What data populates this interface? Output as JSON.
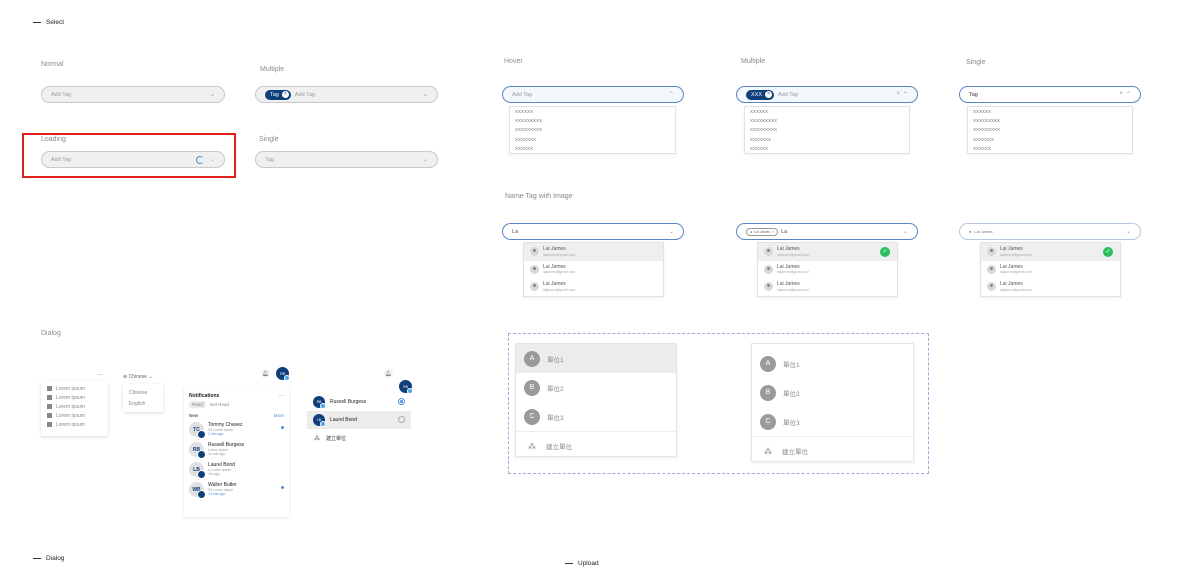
{
  "sections": {
    "select": "Select",
    "dialog": "Dialog",
    "upload": "Upload"
  },
  "labels": {
    "normal": "Normal",
    "multiple_left": "Multiple",
    "loading": "Loading",
    "single_left": "Single",
    "hover": "Hover",
    "multiple_right": "Multiple",
    "single_right": "Single",
    "name_tag_with_image": "Name Tag with Image",
    "dialog": "Dialog"
  },
  "selects": {
    "normal_placeholder": "Add Tag",
    "multiple_tag": "Tag",
    "multiple_placeholder": "Add Tag",
    "loading_placeholder": "Add Tag",
    "single_placeholder": "Tag",
    "hover_placeholder": "Add Tag",
    "multi_open_tag": "XXX",
    "multi_open_placeholder": "Add Tag",
    "single_open_value": "Tag"
  },
  "dropdown_options": [
    "XXXXXX",
    "XXXXXXXXX",
    "XXXXXXXXX",
    "XXXXXXX",
    "XXXXXX"
  ],
  "name_tag": {
    "input_value": "La",
    "chip_label": "Lai James",
    "chip_value_2": "La",
    "single_chip": "Lai James",
    "people": [
      {
        "name": "Lai James",
        "email": "laijames@gmail.com"
      },
      {
        "name": "Lai James",
        "email": "laijames@gmail.com"
      },
      {
        "name": "Lai James",
        "email": "laijames@gmail.com"
      }
    ]
  },
  "dialog": {
    "more_dots": "···",
    "menu_items": [
      "Lorem ipsum",
      "Lorem ipsum",
      "Lorem ipsum",
      "Lorem ipsum",
      "Lorem ipsum"
    ],
    "language_current": "Chinese",
    "language_options": [
      "Chinese",
      "English"
    ],
    "user_initials": "RB",
    "notifications": {
      "title": "Notifications",
      "tab_read": "Read",
      "tab_not_read": "Not Read",
      "new_label": "New",
      "more_label": "More",
      "items": [
        {
          "initials": "TC",
          "name": "Tommy Chavez",
          "sub": "Sit Lorem ipsum",
          "time": "1 min ago",
          "unread": true
        },
        {
          "initials": "RB",
          "name": "Russell Burgess",
          "sub": "Lorem ipsum",
          "time": "1h min ago",
          "unread": false
        },
        {
          "initials": "LB",
          "name": "Laurel Bond",
          "sub": "A Lorem ipsum",
          "time": "1hr ago",
          "unread": false
        },
        {
          "initials": "WB",
          "name": "Walter Butler",
          "sub": "Sit Lorem ipsum",
          "time": "14 min ago",
          "unread": true
        }
      ]
    },
    "accounts": [
      {
        "initials": "RB",
        "name": "Russell Burgess",
        "selected": true
      },
      {
        "initials": "LB",
        "name": "Laurel Bond",
        "selected": false
      }
    ],
    "create_unit": "建立單位"
  },
  "units": {
    "items": [
      {
        "letter": "A",
        "label": "單位1"
      },
      {
        "letter": "B",
        "label": "單位2"
      },
      {
        "letter": "C",
        "label": "單位3"
      }
    ],
    "create": "建立單位"
  },
  "colors": {
    "brand": "#0f3f7a",
    "accent": "#4a90d9",
    "success": "#2bbd5e",
    "highlight": "#e0201a"
  }
}
